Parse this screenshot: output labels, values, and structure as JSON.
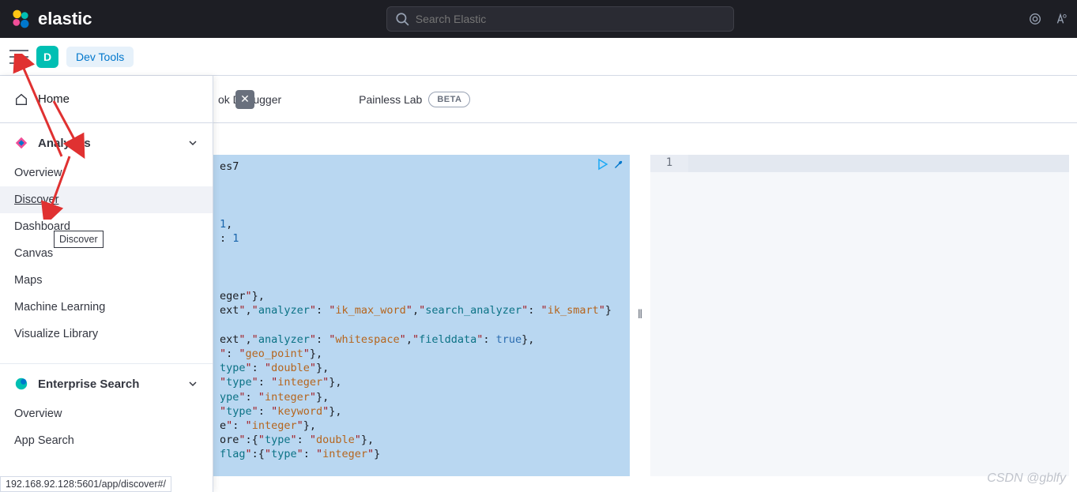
{
  "header": {
    "brand": "elastic",
    "search_placeholder": "Search Elastic"
  },
  "topbar": {
    "badge_letter": "D",
    "breadcrumb": "Dev Tools"
  },
  "sidenav": {
    "home": "Home",
    "sections": [
      {
        "title": "Analytics",
        "items": [
          "Overview",
          "Discover",
          "Dashboard",
          "Canvas",
          "Maps",
          "Machine Learning",
          "Visualize Library"
        ],
        "active_index": 1
      },
      {
        "title": "Enterprise Search",
        "items": [
          "Overview",
          "App Search"
        ]
      }
    ],
    "tooltip": "Discover"
  },
  "tabs": {
    "partial_tab": "ok Debugger",
    "painless": "Painless Lab",
    "beta": "BETA"
  },
  "editor": {
    "first_line": "es7",
    "lines": [
      "",
      "",
      "",
      "1,",
      ": 1",
      "",
      "",
      "",
      "eger\"},",
      "ext\",\"analyzer\": \"ik_max_word\",\"search_analyzer\": \"ik_smart\"}",
      "",
      "ext\",\"analyzer\": \"whitespace\",\"fielddata\": true},",
      "\": \"geo_point\"},",
      "type\": \"double\"},",
      "\"type\": \"integer\"},",
      "ype\": \"integer\"},",
      "\"type\": \"keyword\"},",
      "e\": \"integer\"},",
      "ore\":{\"type\": \"double\"},",
      "flag\":{\"type\": \"integer\"}"
    ]
  },
  "right_pane": {
    "line": "1"
  },
  "status_url": "192.168.92.128:5601/app/discover#/",
  "watermark": "CSDN @gblfy"
}
